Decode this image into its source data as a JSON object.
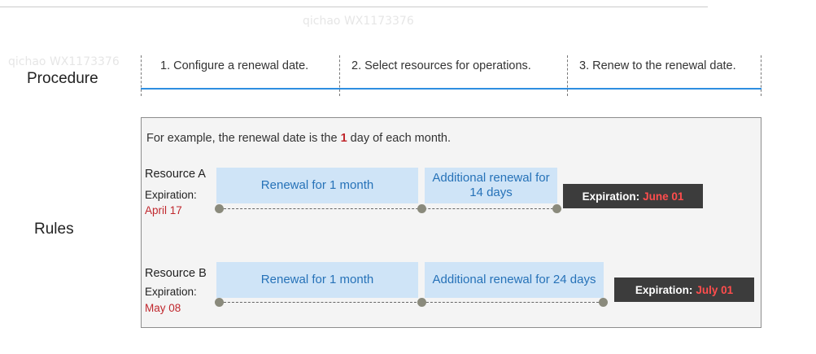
{
  "procedure": {
    "label": "Procedure",
    "steps": [
      "1. Configure a renewal date.",
      "2. Select resources for operations.",
      "3. Renew to the renewal date."
    ]
  },
  "rules": {
    "label": "Rules",
    "example_prefix": "For example, the renewal date is the ",
    "example_day": "1",
    "example_suffix": " day of each month.",
    "resources": [
      {
        "name": "Resource A",
        "expiration_label": "Expiration:",
        "expiration_date": "April 17",
        "renewal": "Renewal for 1 month",
        "additional": "Additional renewal for 14 days",
        "final_label": "Expiration:",
        "final_date": "June 01"
      },
      {
        "name": "Resource B",
        "expiration_label": "Expiration:",
        "expiration_date": "May 08",
        "renewal": "Renewal for 1 month",
        "additional": "Additional renewal for 24 days",
        "final_label": "Expiration:",
        "final_date": "July 01"
      }
    ]
  },
  "watermark_text": "qichao WX1173376",
  "colors": {
    "accent_blue": "#2e8ee0",
    "box_blue": "#cfe4f7",
    "text_blue": "#2672b8",
    "highlight_red": "#c0272d",
    "badge_dark": "#3c3c3c"
  }
}
